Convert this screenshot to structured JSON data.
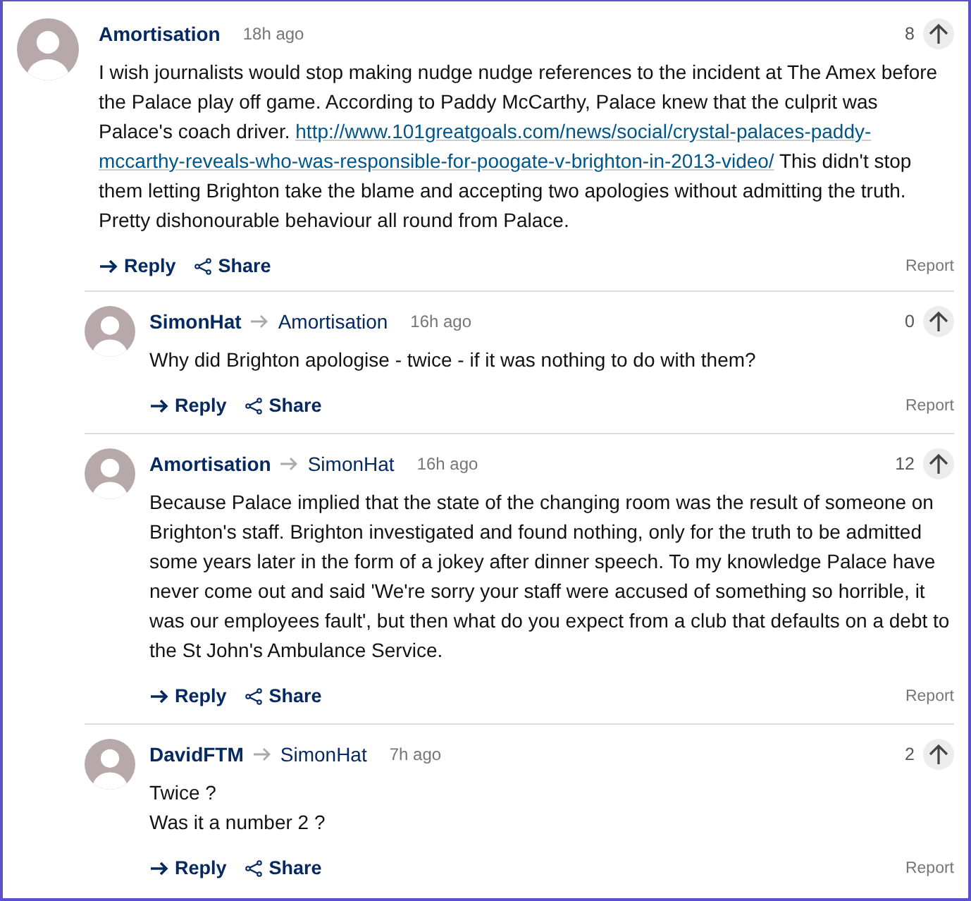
{
  "comments": [
    {
      "author": "Amortisation",
      "time": "18h ago",
      "votes": "8",
      "paragraphs": [
        [
          {
            "kind": "text",
            "text": "I wish journalists would stop making nudge nudge references to the incident at The Amex before the Palace play off game. According to Paddy McCarthy, Palace knew that the culprit was Palace's coach driver. "
          },
          {
            "kind": "link",
            "text": "http://www.101greatgoals.com/news/social/crystal-palaces-paddy-"
          },
          {
            "kind": "link",
            "text": "mccarthy-reveals-who-was-responsible-for-poogate-v-brighton-in-2013-video/"
          },
          {
            "kind": "text",
            "text": " This didn't stop them letting Brighton take the blame and accepting two apologies without admitting the truth. Pretty dishonourable behaviour all round from Palace."
          }
        ]
      ],
      "actions": {
        "reply": "Reply",
        "share": "Share",
        "report": "Report"
      },
      "replies": [
        {
          "author": "SimonHat",
          "reply_to": "Amortisation",
          "time": "16h ago",
          "votes": "0",
          "paragraphs": [
            [
              {
                "kind": "text",
                "text": "Why did Brighton apologise - twice - if it was nothing to do with them?"
              }
            ]
          ],
          "actions": {
            "reply": "Reply",
            "share": "Share",
            "report": "Report"
          }
        },
        {
          "author": "Amortisation",
          "reply_to": "SimonHat",
          "time": "16h ago",
          "votes": "12",
          "paragraphs": [
            [
              {
                "kind": "text",
                "text": "Because Palace implied that the state of the changing room was the result of someone on Brighton's staff. Brighton investigated and found nothing, only for the truth to be admitted some years later in the form of a jokey after dinner speech. To my knowledge Palace have never come out and said 'We're sorry your staff were accused of something so horrible, it was our employees fault', but then what do you expect from a club that defaults on a debt to the St John's Ambulance Service."
              }
            ]
          ],
          "actions": {
            "reply": "Reply",
            "share": "Share",
            "report": "Report"
          }
        },
        {
          "author": "DavidFTM",
          "reply_to": "SimonHat",
          "time": "7h ago",
          "votes": "2",
          "paragraphs": [
            [
              {
                "kind": "text",
                "text": "Twice ?"
              }
            ],
            [
              {
                "kind": "text",
                "text": "Was it a number 2 ?"
              }
            ]
          ],
          "actions": {
            "reply": "Reply",
            "share": "Share",
            "report": "Report"
          }
        }
      ]
    }
  ]
}
